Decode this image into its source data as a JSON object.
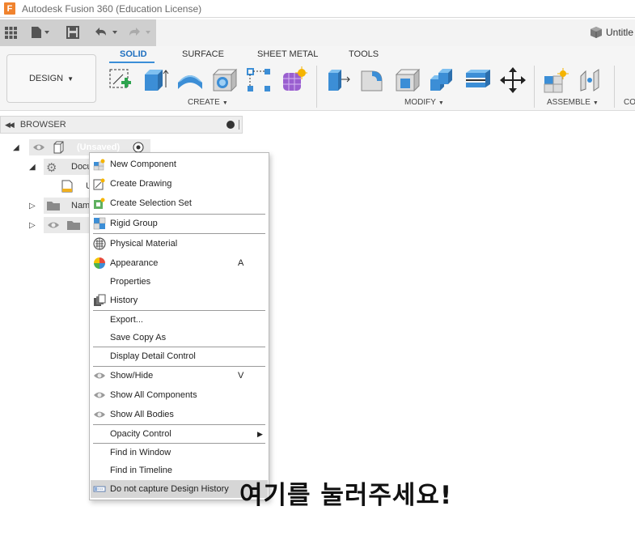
{
  "window": {
    "title": "Autodesk Fusion 360 (Education License)",
    "logo_letter": "F"
  },
  "qa": {
    "doc_tab": "Untitle"
  },
  "toolbar": {
    "design_label": "DESIGN",
    "tabs": [
      "SOLID",
      "SURFACE",
      "SHEET METAL",
      "TOOLS"
    ],
    "active_tab": "SOLID",
    "groups": {
      "create": "CREATE",
      "modify": "MODIFY",
      "assemble": "ASSEMBLE",
      "construct": "CO"
    }
  },
  "browser": {
    "title": "BROWSER",
    "root_label": "(Unsaved)",
    "rows": [
      "Docu",
      "U",
      "Nam"
    ]
  },
  "context_menu": {
    "items": [
      {
        "label": "New Component",
        "icon": "new-component-icon"
      },
      {
        "label": "Create Drawing",
        "icon": "create-drawing-icon"
      },
      {
        "label": "Create Selection Set",
        "icon": "selection-set-icon"
      },
      {
        "label": "Rigid Group",
        "icon": "rigid-group-icon"
      },
      {
        "label": "Physical Material",
        "icon": "physical-material-icon"
      },
      {
        "label": "Appearance",
        "icon": "appearance-icon",
        "shortcut": "A"
      },
      {
        "label": "Properties"
      },
      {
        "label": "History",
        "icon": "history-icon"
      },
      {
        "label": "Export..."
      },
      {
        "label": "Save Copy As"
      },
      {
        "label": "Display Detail Control"
      },
      {
        "label": "Show/Hide",
        "icon": "eye-icon",
        "shortcut": "V"
      },
      {
        "label": "Show All Components",
        "icon": "eye-icon"
      },
      {
        "label": "Show All Bodies",
        "icon": "eye-icon"
      },
      {
        "label": "Opacity Control",
        "submenu": true
      },
      {
        "label": "Find in Window"
      },
      {
        "label": "Find in Timeline"
      },
      {
        "label": "Do not capture Design History",
        "icon": "history-capture-icon",
        "highlighted": true
      }
    ]
  },
  "overlay": {
    "text": "여기를 눌러주세요!"
  }
}
